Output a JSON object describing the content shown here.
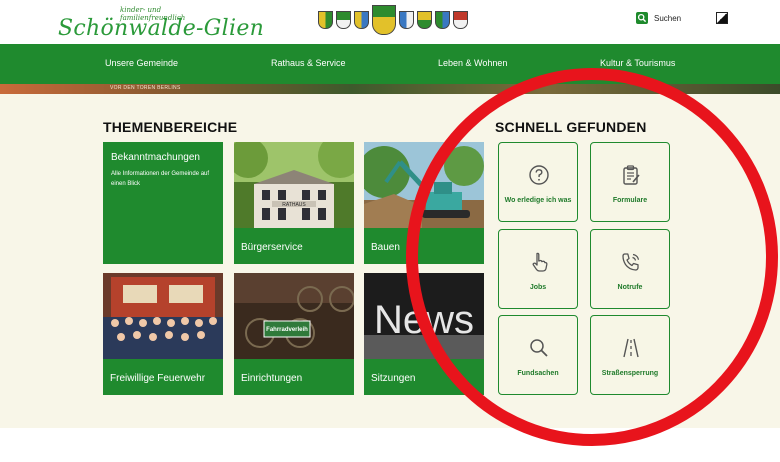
{
  "header": {
    "logo_tagline": "kinder- und familienfreundlich",
    "logo_main": "Schönwalde-Glien",
    "search_label": "Suchen",
    "crest_colors": [
      "#2e8b2e",
      "#e2c12a",
      "#3a78c2",
      "#2e8b2e",
      "#3a78c2",
      "#e2c12a",
      "#2e8b2e",
      "#c0392b"
    ]
  },
  "nav": {
    "items": [
      "Unsere Gemeinde",
      "Rathaus & Service",
      "Leben & Wohnen",
      "Kultur & Tourismus"
    ]
  },
  "hero": {
    "breadcrumb": "VOR DEN TOREN BERLINS"
  },
  "themen": {
    "title": "THEMENBEREICHE",
    "tiles": [
      {
        "label": "Bekanntmachungen",
        "desc": "Alle Informationen der Gemeinde auf einen Blick"
      },
      {
        "label": "Bürgerservice",
        "img_text": "RATHAUS"
      },
      {
        "label": "Bauen"
      },
      {
        "label": "Freiwillige Feuerwehr"
      },
      {
        "label": "Einrichtungen",
        "img_text": "Fahrradverleih"
      },
      {
        "label": "Sitzungen",
        "img_text": "News"
      }
    ]
  },
  "schnell": {
    "title": "SCHNELL GEFUNDEN",
    "items": [
      {
        "label": "Wo erledige ich was",
        "icon": "question-circle-icon"
      },
      {
        "label": "Formulare",
        "icon": "clipboard-icon"
      },
      {
        "label": "Jobs",
        "icon": "pointing-hand-icon"
      },
      {
        "label": "Notrufe",
        "icon": "phone-icon"
      },
      {
        "label": "Fundsachen",
        "icon": "magnifier-icon"
      },
      {
        "label": "Straßensperrung",
        "icon": "road-icon"
      }
    ]
  },
  "colors": {
    "brand_green": "#1f8a2e",
    "content_bg": "#f8f6e8",
    "annotation_red": "#e8141c"
  }
}
